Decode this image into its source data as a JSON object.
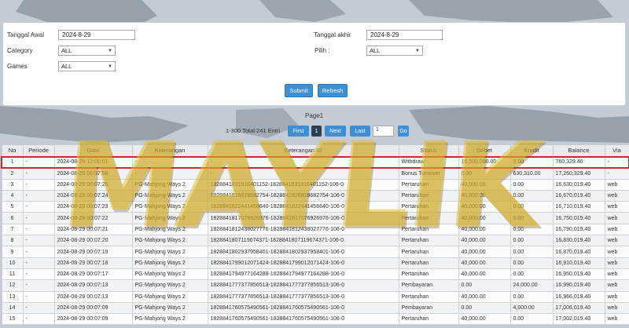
{
  "filters": {
    "tanggal_awal_label": "Tanggal Awal",
    "tanggal_awal_value": "2024-8-29",
    "tanggal_akhir_label": "Tanggal akhir",
    "tanggal_akhir_value": "2024-8-29",
    "category_label": "Category",
    "category_value": "ALL",
    "pilih_label": "Pilih  :",
    "pilih_value": "ALL",
    "games_label": "Games",
    "games_value": "ALL",
    "submit_label": "Submit",
    "refresh_label": "Refresh"
  },
  "pager": {
    "page_label": "Page1",
    "info": "1-300 Total:241 Entri",
    "first": "First",
    "current": "1",
    "next": "Next",
    "last": "Last",
    "page_input": "1",
    "go": "Go"
  },
  "watermark": "MAYLIK",
  "table": {
    "headers": [
      "No",
      "Periode",
      "Date",
      "Keterangan",
      "Keterangan ID",
      "Status",
      "Debet",
      "Kredit",
      "Balance",
      "Via"
    ],
    "rows": [
      {
        "no": "1",
        "periode": "-",
        "date": "2024-08-29 12:00:01",
        "ket": "-",
        "ket_id": "-",
        "status": "Withdraw",
        "debet": "16,500,000.00",
        "kredit": "0.00",
        "balance": "760,329.40",
        "via": "-"
      },
      {
        "no": "2",
        "periode": "-",
        "date": "2024-08-29 06:57:58",
        "ket": "-",
        "ket_id": "-",
        "status": "Bonus Turnover",
        "debet": "0.00",
        "kredit": "630,310.00",
        "balance": "17,260,329.40",
        "via": "-"
      },
      {
        "no": "3",
        "periode": "-",
        "date": "2024-08-29 00:07:26",
        "ket": "PG-Mahjong Ways 2",
        "ket_id": "1828841831916401152-1828841831916401152-106-0",
        "status": "Pertaruhan",
        "debet": "40,000.00",
        "kredit": "0.00",
        "balance": "16,630,019.40",
        "via": "web"
      },
      {
        "no": "4",
        "periode": "-",
        "date": "2024-08-29 00:07:24",
        "ket": "PG-Mahjong Ways 2",
        "ket_id": "1828841826828682754-1828841826828682754-106-0",
        "status": "Pertaruhan",
        "debet": "40,000.00",
        "kredit": "0.00",
        "balance": "16,670,019.40",
        "via": "web"
      },
      {
        "no": "5",
        "periode": "-",
        "date": "2024-08-29 00:07:23",
        "ket": "PG-Mahjong Ways 2",
        "ket_id": "1828841822441456640-1828841822441456640-106-0",
        "status": "Pertaruhan",
        "debet": "40,000.00",
        "kredit": "0.00",
        "balance": "16,710,019.40",
        "via": "web"
      },
      {
        "no": "6",
        "periode": "-",
        "date": "2024-08-29 00:07:22",
        "ket": "PG-Mahjong Ways 2",
        "ket_id": "1828841817076926976-1828841817076926976-106-0",
        "status": "Pertaruhan",
        "debet": "40,000.00",
        "kredit": "0.00",
        "balance": "16,750,019.40",
        "via": "web"
      },
      {
        "no": "7",
        "periode": "-",
        "date": "2024-08-29 00:07:21",
        "ket": "PG-Mahjong Ways 2",
        "ket_id": "1828841812438027776-1828841812438027776-106-0",
        "status": "Pertaruhan",
        "debet": "40,000.00",
        "kredit": "0.00",
        "balance": "16,790,019.40",
        "via": "web"
      },
      {
        "no": "8",
        "periode": "-",
        "date": "2024-08-29 00:07:20",
        "ket": "PG-Mahjong Ways 2",
        "ket_id": "1828841807119674371-1828841807119674371-106-0",
        "status": "Pertaruhan",
        "debet": "40,000.00",
        "kredit": "0.00",
        "balance": "16,830,019.40",
        "via": "web"
      },
      {
        "no": "9",
        "periode": "-",
        "date": "2024-08-29 00:07:19",
        "ket": "PG-Mahjong Ways 2",
        "ket_id": "1828841802937958401-1828841802937958401-106-0",
        "status": "Pertaruhan",
        "debet": "40,000.00",
        "kredit": "0.00",
        "balance": "16,870,019.40",
        "via": "web"
      },
      {
        "no": "10",
        "periode": "-",
        "date": "2024-08-29 00:07:18",
        "ket": "PG-Mahjong Ways 2",
        "ket_id": "1828841799012071424-1828841799012071424-106-0",
        "status": "Pertaruhan",
        "debet": "40,000.00",
        "kredit": "0.00",
        "balance": "16,910,019.40",
        "via": "web"
      },
      {
        "no": "11",
        "periode": "-",
        "date": "2024-08-29 00:07:17",
        "ket": "PG-Mahjong Ways 2",
        "ket_id": "1828841794977164288-1828841794977164288-106-0",
        "status": "Pertaruhan",
        "debet": "40,000.00",
        "kredit": "0.00",
        "balance": "16,950,019.40",
        "via": "web"
      },
      {
        "no": "12",
        "periode": "-",
        "date": "2024-08-29 00:07:13",
        "ket": "PG-Mahjong Ways 2",
        "ket_id": "1828841777377856513-1828841777377856513-106-0",
        "status": "Pembayaran",
        "debet": "0.00",
        "kredit": "24,000.00",
        "balance": "16,990,019.40",
        "via": "web"
      },
      {
        "no": "13",
        "periode": "-",
        "date": "2024-08-29 00:07:13",
        "ket": "PG-Mahjong Ways 2",
        "ket_id": "1828841777377856513-1828841777377856513-106-0",
        "status": "Pertaruhan",
        "debet": "40,000.00",
        "kredit": "0.00",
        "balance": "16,966,019.40",
        "via": "web"
      },
      {
        "no": "14",
        "periode": "-",
        "date": "2024-08-29 00:07:09",
        "ket": "PG-Mahjong Ways 2",
        "ket_id": "1828841760575490561-1828841760575490561-106-0",
        "status": "Pembayaran",
        "debet": "0.00",
        "kredit": "4,000.00",
        "balance": "17,006,019.40",
        "via": "web"
      },
      {
        "no": "15",
        "periode": "-",
        "date": "2024-08-29 00:07:09",
        "ket": "PG-Mahjong Ways 2",
        "ket_id": "1828841760575490561-1828841760575490561-106-0",
        "status": "Pertaruhan",
        "debet": "40,000.00",
        "kredit": "0.00",
        "balance": "17,002,019.40",
        "via": "web"
      }
    ]
  }
}
